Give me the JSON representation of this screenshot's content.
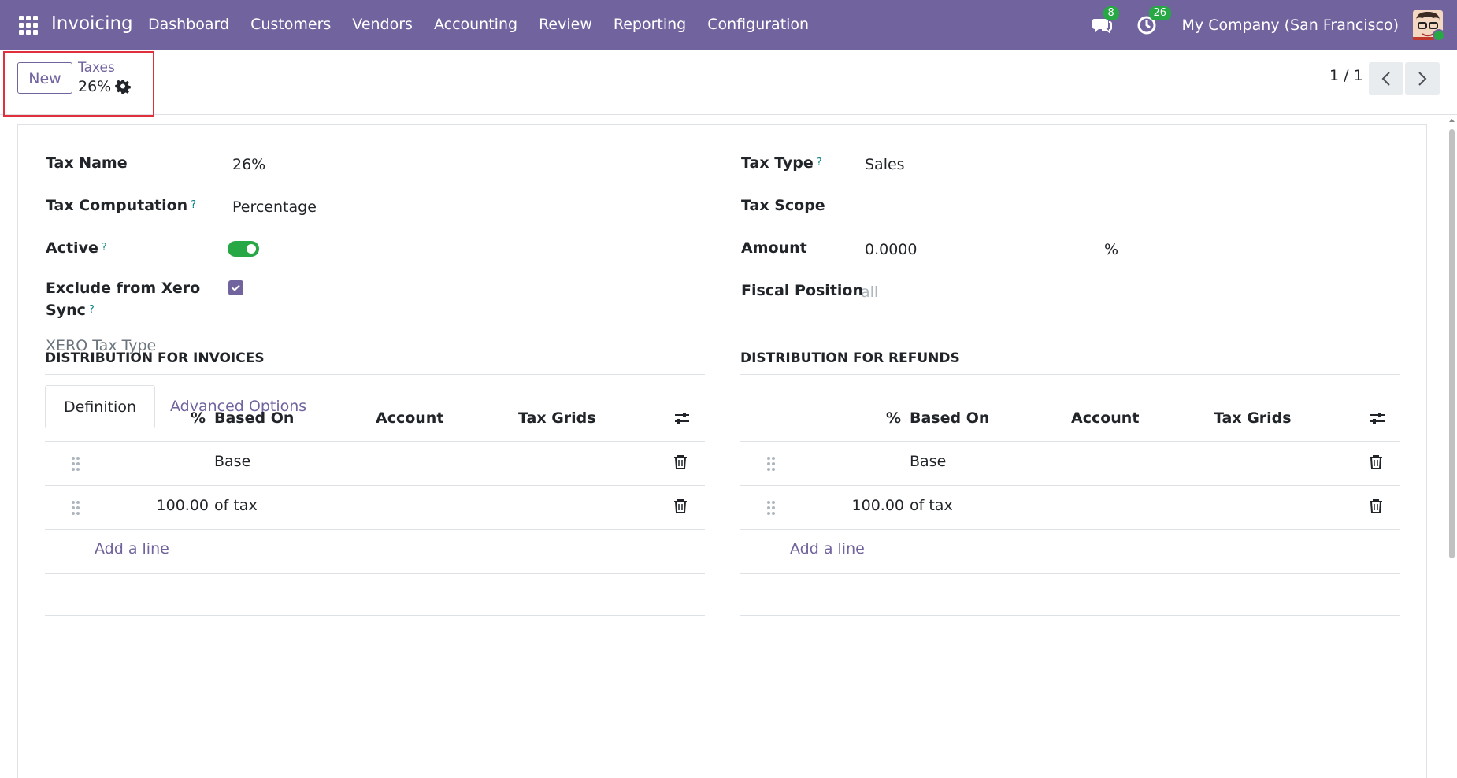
{
  "navbar": {
    "app_name": "Invoicing",
    "menu": [
      "Dashboard",
      "Customers",
      "Vendors",
      "Accounting",
      "Review",
      "Reporting",
      "Configuration"
    ],
    "messages_count": "8",
    "activities_count": "26",
    "company": "My Company (San Francisco)"
  },
  "control_panel": {
    "new_label": "New",
    "breadcrumb": "Taxes",
    "record_name": "26%",
    "pager": "1 / 1"
  },
  "form": {
    "tax_name_label": "Tax Name",
    "tax_name_value": "26%",
    "tax_computation_label": "Tax Computation",
    "tax_computation_value": "Percentage",
    "active_label": "Active",
    "active_value": true,
    "exclude_xero_label": "Exclude from Xero Sync",
    "exclude_xero_value": true,
    "xero_tax_type_label": "XERO Tax Type",
    "tax_type_label": "Tax Type",
    "tax_type_value": "Sales",
    "tax_scope_label": "Tax Scope",
    "amount_label": "Amount",
    "amount_value": "0.0000",
    "amount_unit": "%",
    "fiscal_position_label": "Fiscal Position",
    "fiscal_position_placeholder": "all",
    "help_mark": "?"
  },
  "tabs": [
    "Definition",
    "Advanced Options"
  ],
  "distribution": {
    "headers": {
      "percent": "%",
      "based_on": "Based On",
      "account": "Account",
      "tax_grids": "Tax Grids"
    },
    "add_line": "Add a line",
    "invoices": {
      "title": "DISTRIBUTION FOR INVOICES",
      "rows": [
        {
          "percent": "",
          "based_on": "Base"
        },
        {
          "percent": "100.00",
          "based_on": "of tax"
        }
      ]
    },
    "refunds": {
      "title": "DISTRIBUTION FOR REFUNDS",
      "rows": [
        {
          "percent": "",
          "based_on": "Base"
        },
        {
          "percent": "100.00",
          "based_on": "of tax"
        }
      ]
    }
  },
  "colors": {
    "brand": "#71639e",
    "success": "#28a745",
    "highlight": "#e0303e"
  }
}
